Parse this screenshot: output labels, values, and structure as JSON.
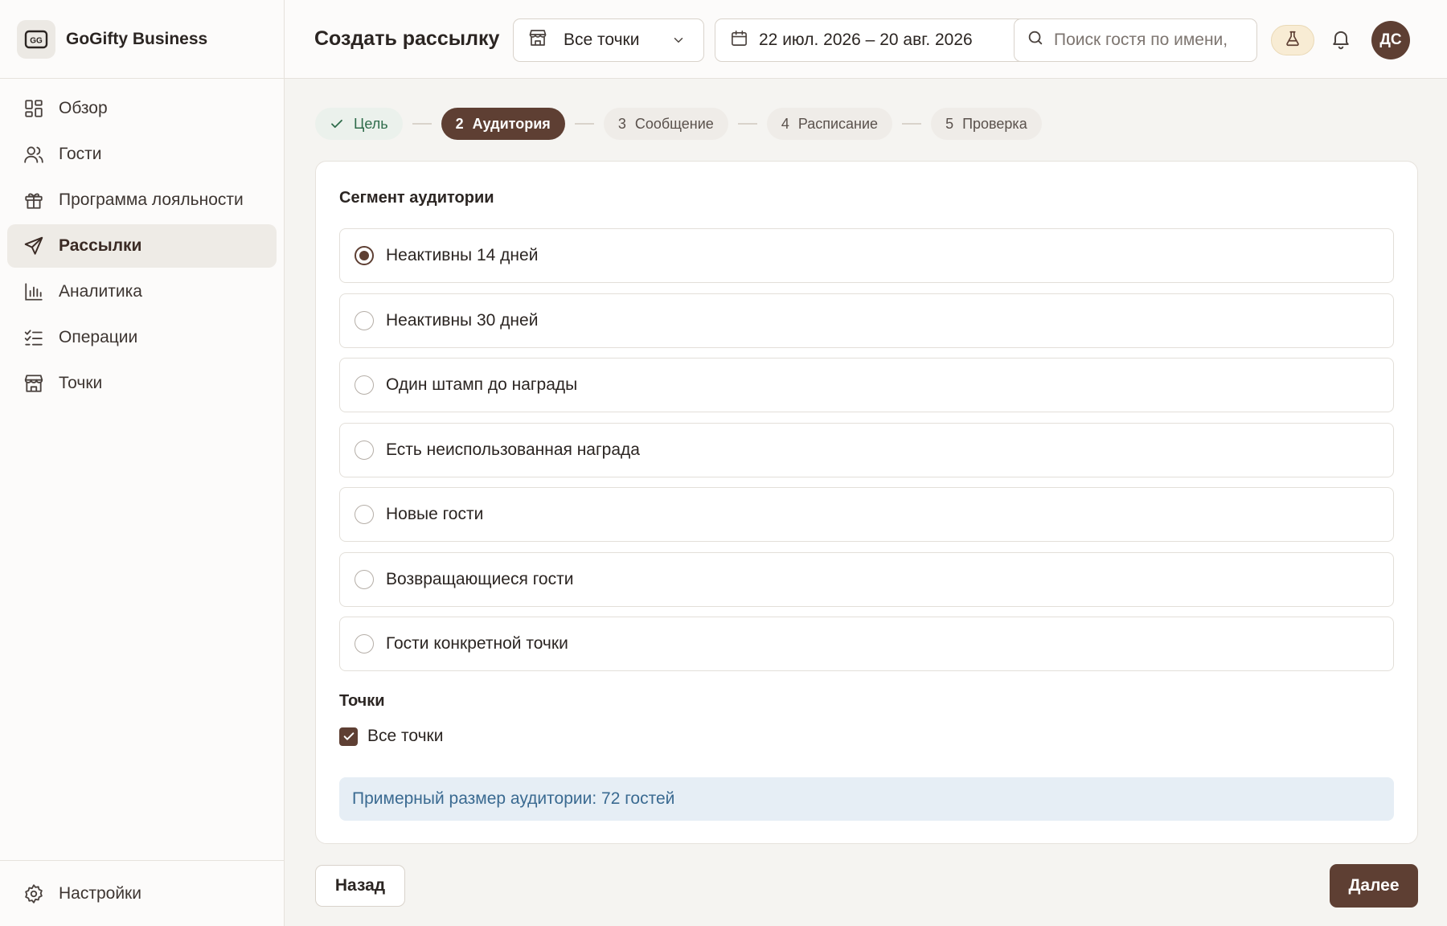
{
  "app": {
    "brand_name": "GoGifty Business",
    "logo_text": "GG"
  },
  "sidebar": {
    "items": [
      {
        "label": "Обзор",
        "icon": "grid-icon"
      },
      {
        "label": "Гости",
        "icon": "users-icon"
      },
      {
        "label": "Программа лояльности",
        "icon": "gift-icon"
      },
      {
        "label": "Рассылки",
        "icon": "send-icon",
        "active": true
      },
      {
        "label": "Аналитика",
        "icon": "bar-chart-icon"
      },
      {
        "label": "Операции",
        "icon": "list-check-icon"
      },
      {
        "label": "Точки",
        "icon": "store-icon"
      }
    ],
    "settings_label": "Настройки"
  },
  "header": {
    "title": "Создать рассылку",
    "location_select": "Все точки",
    "date_range": "22 июл. 2026 – 20 авг. 2026",
    "search_placeholder": "Поиск гостя по имени,",
    "avatar_initials": "ДС"
  },
  "stepper": {
    "steps": [
      {
        "num": "",
        "label": "Цель",
        "state": "done"
      },
      {
        "num": "2",
        "label": "Аудитория",
        "state": "current"
      },
      {
        "num": "3",
        "label": "Сообщение",
        "state": "pending"
      },
      {
        "num": "4",
        "label": "Расписание",
        "state": "pending"
      },
      {
        "num": "5",
        "label": "Проверка",
        "state": "pending"
      }
    ]
  },
  "audience": {
    "section_title": "Сегмент аудитории",
    "segments": [
      {
        "label": "Неактивны 14 дней",
        "selected": true
      },
      {
        "label": "Неактивны 30 дней",
        "selected": false
      },
      {
        "label": "Один штамп до награды",
        "selected": false
      },
      {
        "label": "Есть неиспользованная награда",
        "selected": false
      },
      {
        "label": "Новые гости",
        "selected": false
      },
      {
        "label": "Возвращающиеся гости",
        "selected": false
      },
      {
        "label": "Гости конкретной точки",
        "selected": false
      }
    ],
    "points_title": "Точки",
    "all_points_label": "Все точки",
    "all_points_checked": true,
    "estimate_text": "Примерный размер аудитории: 72 гостей"
  },
  "footer": {
    "back_label": "Назад",
    "next_label": "Далее"
  },
  "colors": {
    "accent": "#5e3f33",
    "done_green": "#2f6c4b",
    "info_bg": "#e6eef5",
    "info_text": "#3a6a91"
  }
}
